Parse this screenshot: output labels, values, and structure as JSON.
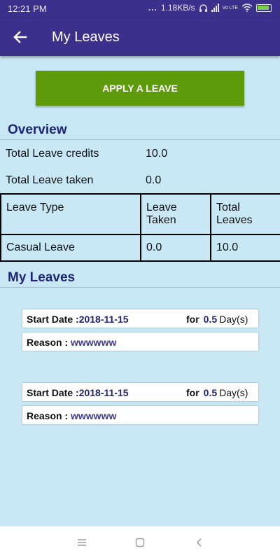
{
  "status_bar": {
    "time": "12:21 PM",
    "dots": "...",
    "speed": "1.18KB/s",
    "network_label": "Vo LTE",
    "icons": [
      "headset-icon",
      "signal-icon",
      "volte-icon",
      "wifi-icon",
      "battery-charging-icon"
    ]
  },
  "app_bar": {
    "title": "My Leaves",
    "back_icon": "arrow-left-icon"
  },
  "apply_button": {
    "label": "APPLY A LEAVE",
    "color": "#5e9b0b"
  },
  "overview": {
    "title": "Overview",
    "total_credits": {
      "label": "Total Leave credits",
      "value": "10.0"
    },
    "total_taken": {
      "label": "Total Leave taken",
      "value": "0.0"
    }
  },
  "leave_table": {
    "headers": [
      "Leave Type",
      "Leave Taken",
      "Total Leaves"
    ],
    "rows": [
      [
        "Casual Leave",
        "0.0",
        "10.0"
      ]
    ]
  },
  "my_leaves": {
    "title": "My Leaves",
    "items": [
      {
        "start_label": "Start Date :",
        "start_date": "2018-11-15",
        "for_label": "for",
        "days": "0.5",
        "days_unit": "Day(s)",
        "reason_label": "Reason :",
        "reason": "wwwwww"
      },
      {
        "start_label": "Start Date :",
        "start_date": "2018-11-15",
        "for_label": "for",
        "days": "0.5",
        "days_unit": "Day(s)",
        "reason_label": "Reason :",
        "reason": "wwwwww"
      }
    ]
  },
  "nav_bar": {
    "icons": [
      "menu-icon",
      "home-square-icon",
      "back-chevron-icon"
    ]
  },
  "colors": {
    "primary": "#3d2f8c",
    "background": "#c8e8f6",
    "accent_text": "#1f2474"
  }
}
